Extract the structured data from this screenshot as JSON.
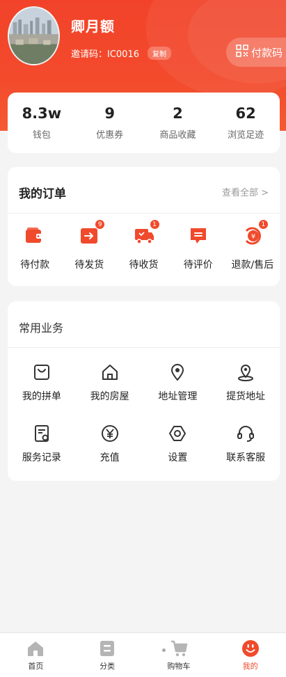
{
  "profile": {
    "name": "卿月额",
    "invite_label": "邀请码：IC0016",
    "copy_label": "复制",
    "pay_code_label": "付款码"
  },
  "stats": [
    {
      "value": "8.3w",
      "label": "钱包"
    },
    {
      "value": "9",
      "label": "优惠券"
    },
    {
      "value": "2",
      "label": "商品收藏"
    },
    {
      "value": "62",
      "label": "浏览足迹"
    }
  ],
  "orders": {
    "title": "我的订单",
    "view_all": "查看全部 >",
    "items": [
      {
        "label": "待付款",
        "icon": "wallet-icon",
        "badge": ""
      },
      {
        "label": "待发货",
        "icon": "shipping-box-icon",
        "badge": "9"
      },
      {
        "label": "待收货",
        "icon": "delivery-truck-icon",
        "badge": "1"
      },
      {
        "label": "待评价",
        "icon": "comment-icon",
        "badge": ""
      },
      {
        "label": "退款/售后",
        "icon": "refund-icon",
        "badge": "1"
      }
    ]
  },
  "services": {
    "title": "常用业务",
    "items": [
      {
        "label": "我的拼单",
        "icon": "shopping-bag-icon"
      },
      {
        "label": "我的房屋",
        "icon": "house-icon"
      },
      {
        "label": "地址管理",
        "icon": "location-pin-icon"
      },
      {
        "label": "提货地址",
        "icon": "pickup-location-icon"
      },
      {
        "label": "服务记录",
        "icon": "service-record-icon"
      },
      {
        "label": "充值",
        "icon": "yuan-coin-icon"
      },
      {
        "label": "设置",
        "icon": "settings-hex-icon"
      },
      {
        "label": "联系客服",
        "icon": "headset-icon"
      }
    ]
  },
  "tabbar": [
    {
      "label": "首页",
      "icon": "home-icon",
      "active": false
    },
    {
      "label": "分类",
      "icon": "category-icon",
      "active": false
    },
    {
      "label": "购物车",
      "icon": "cart-icon",
      "active": false
    },
    {
      "label": "我的",
      "icon": "smile-face-icon",
      "active": true
    }
  ],
  "colors": {
    "accent": "#f04a2c",
    "header_top": "#f2432a",
    "background": "#f4f4f5"
  }
}
